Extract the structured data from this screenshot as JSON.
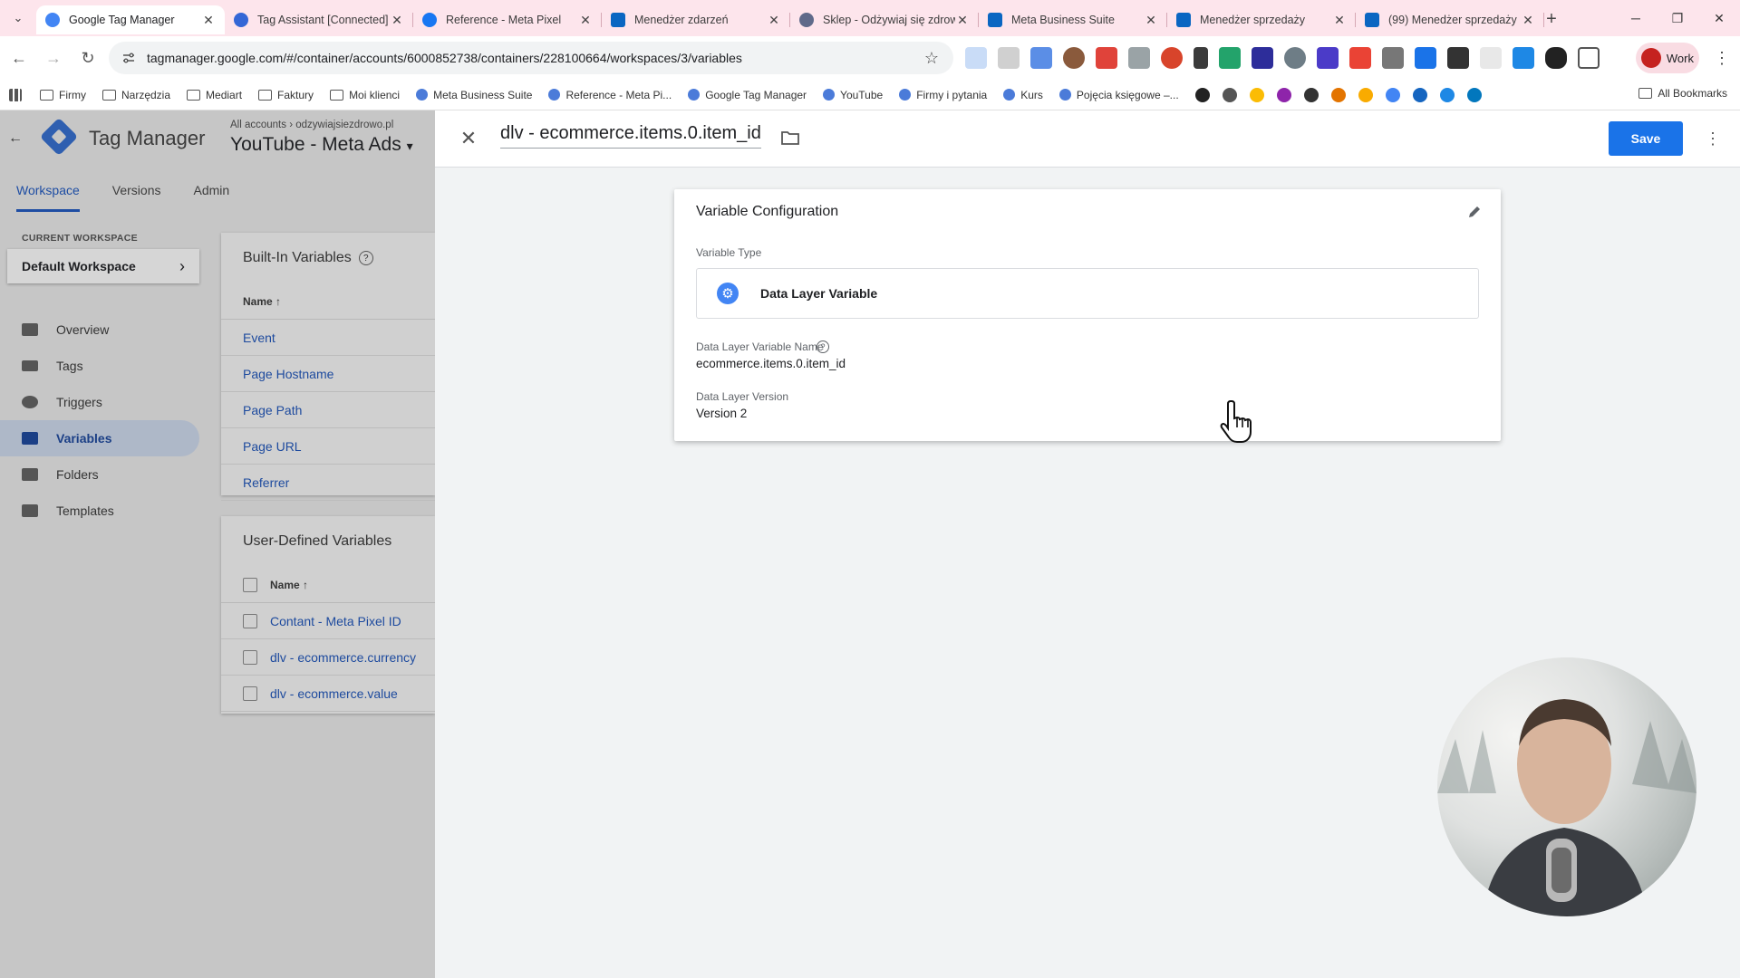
{
  "browser": {
    "tabs": [
      {
        "title": "Google Tag Manager",
        "active": true,
        "icon": "gtm-icon"
      },
      {
        "title": "Tag Assistant [Connected]",
        "active": false,
        "icon": "tag-assistant-icon"
      },
      {
        "title": "Reference - Meta Pixel",
        "active": false,
        "icon": "facebook-icon"
      },
      {
        "title": "Menedżer zdarzeń",
        "active": false,
        "icon": "meta-icon"
      },
      {
        "title": "Sklep - Odżywiaj się zdrowo",
        "active": false,
        "icon": "store-icon"
      },
      {
        "title": "Meta Business Suite",
        "active": false,
        "icon": "meta-icon"
      },
      {
        "title": "Menedżer sprzedaży",
        "active": false,
        "icon": "meta-icon"
      },
      {
        "title": "(99) Menedżer sprzedaży",
        "active": false,
        "icon": "meta-icon"
      }
    ],
    "url": "tagmanager.google.com/#/container/accounts/6000852738/containers/228100664/workspaces/3/variables",
    "profile_label": "Work",
    "bookmarks": [
      "Firmy",
      "Narzędzia",
      "Mediart",
      "Faktury",
      "Moi klienci",
      "Meta Business Suite",
      "Reference - Meta Pi...",
      "Google Tag Manager",
      "YouTube",
      "Firmy i pytania",
      "Kurs",
      "Pojęcia księgowe –..."
    ],
    "all_bookmarks": "All Bookmarks"
  },
  "gtm": {
    "app_title": "Tag Manager",
    "breadcrumb": "All accounts › odzywiajsiezdrowo.pl",
    "container_name": "YouTube - Meta Ads",
    "nav_tabs": [
      "Workspace",
      "Versions",
      "Admin"
    ],
    "current_workspace_label": "CURRENT WORKSPACE",
    "workspace_name": "Default Workspace",
    "sidenav": [
      "Overview",
      "Tags",
      "Triggers",
      "Variables",
      "Folders",
      "Templates"
    ],
    "builtin": {
      "title": "Built-In Variables",
      "col_name": "Name",
      "rows": [
        "Event",
        "Page Hostname",
        "Page Path",
        "Page URL",
        "Referrer"
      ]
    },
    "userdef": {
      "title": "User-Defined Variables",
      "col_name": "Name",
      "rows": [
        "Contant - Meta Pixel ID",
        "dlv - ecommerce.currency",
        "dlv - ecommerce.value"
      ]
    }
  },
  "panel": {
    "variable_name": "dlv - ecommerce.items.0.item_id",
    "save_label": "Save",
    "config_title": "Variable Configuration",
    "type_label": "Variable Type",
    "type_name": "Data Layer Variable",
    "dlv_name_label": "Data Layer Variable Name",
    "dlv_name_value": "ecommerce.items.0.item_id",
    "dlv_version_label": "Data Layer Version",
    "dlv_version_value": "Version 2"
  },
  "colors": {
    "accent": "#1a73e8",
    "gtm_blue": "#1e4da3",
    "tabstrip": "#fde5ec"
  }
}
